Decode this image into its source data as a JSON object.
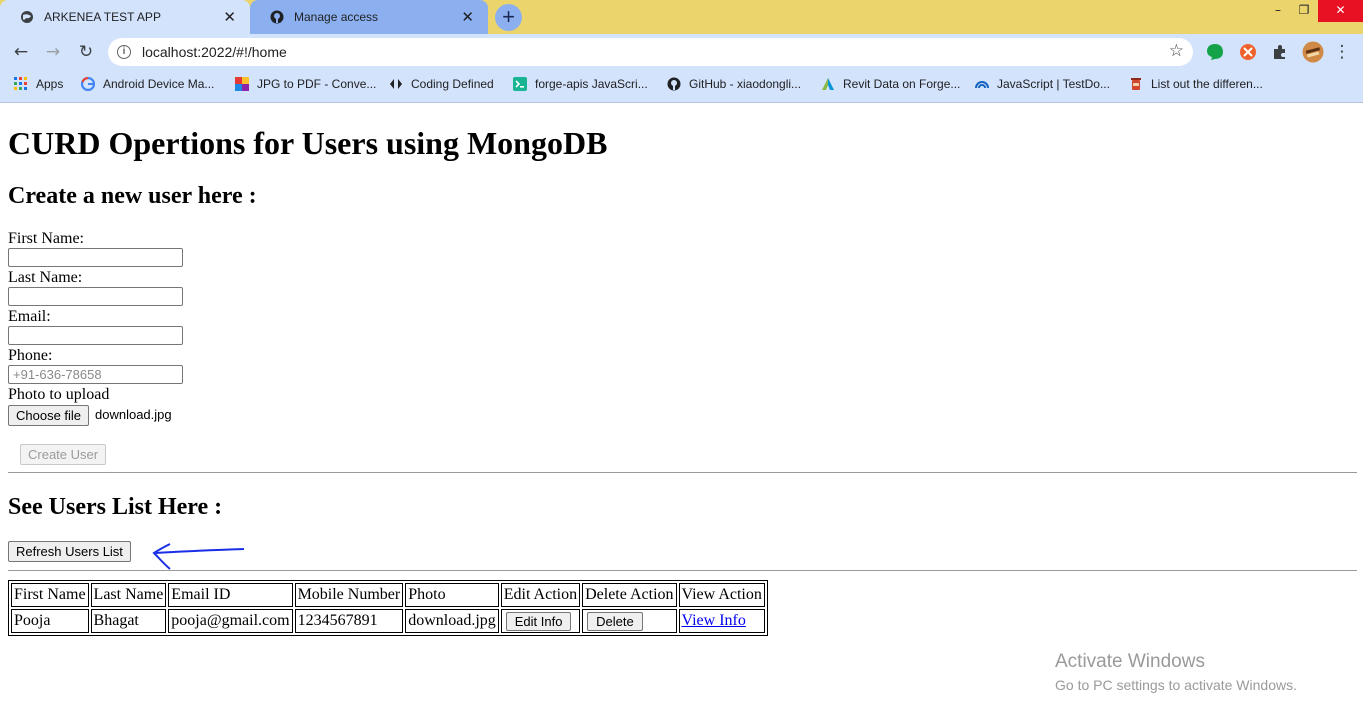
{
  "browser": {
    "tabs": [
      {
        "title": "ARKENEA TEST APP",
        "active": true
      },
      {
        "title": "Manage access",
        "active": false
      }
    ],
    "url": "localhost:2022/#!/home",
    "bookmarks": [
      {
        "label": "Apps",
        "icon": "apps-grid-icon"
      },
      {
        "label": "Android Device Ma...",
        "icon": "google-icon"
      },
      {
        "label": "JPG to PDF - Conve...",
        "icon": "jpg2pdf-icon"
      },
      {
        "label": "Coding Defined",
        "icon": "coding-defined-icon"
      },
      {
        "label": "forge-apis JavaScri...",
        "icon": "terminal-icon"
      },
      {
        "label": "GitHub - xiaodongli...",
        "icon": "github-icon"
      },
      {
        "label": "Revit Data on Forge...",
        "icon": "autodesk-icon"
      },
      {
        "label": "JavaScript | TestDo...",
        "icon": "testdome-icon"
      },
      {
        "label": "List out the differen...",
        "icon": "cup-icon"
      }
    ]
  },
  "page": {
    "title": "CURD Opertions for Users using MongoDB",
    "create_heading": "Create a new user here :",
    "form": {
      "first_name_label": "First Name:",
      "last_name_label": "Last Name:",
      "email_label": "Email:",
      "phone_label": "Phone:",
      "phone_placeholder": "+91-636-78658",
      "photo_label": "Photo to upload",
      "choose_file_label": "Choose file",
      "file_name": "download.jpg",
      "create_button": "Create User"
    },
    "list_heading": "See Users List Here :",
    "refresh_button": "Refresh Users List",
    "table": {
      "headers": [
        "First Name",
        "Last Name",
        "Email ID",
        "Mobile Number",
        "Photo",
        "Edit Action",
        "Delete Action",
        "View Action"
      ],
      "rows": [
        {
          "first_name": "Pooja",
          "last_name": "Bhagat",
          "email": "pooja@gmail.com",
          "mobile": "1234567891",
          "photo": "download.jpg",
          "edit": "Edit Info",
          "delete": "Delete",
          "view": "View Info"
        }
      ]
    }
  },
  "watermark": {
    "title": "Activate Windows",
    "subtitle": "Go to PC settings to activate Windows."
  },
  "colors": {
    "tabstrip": "#ecd46c",
    "toolbar": "#d3e3fb",
    "link": "#0000ee",
    "arrow": "#1a2ee8"
  }
}
